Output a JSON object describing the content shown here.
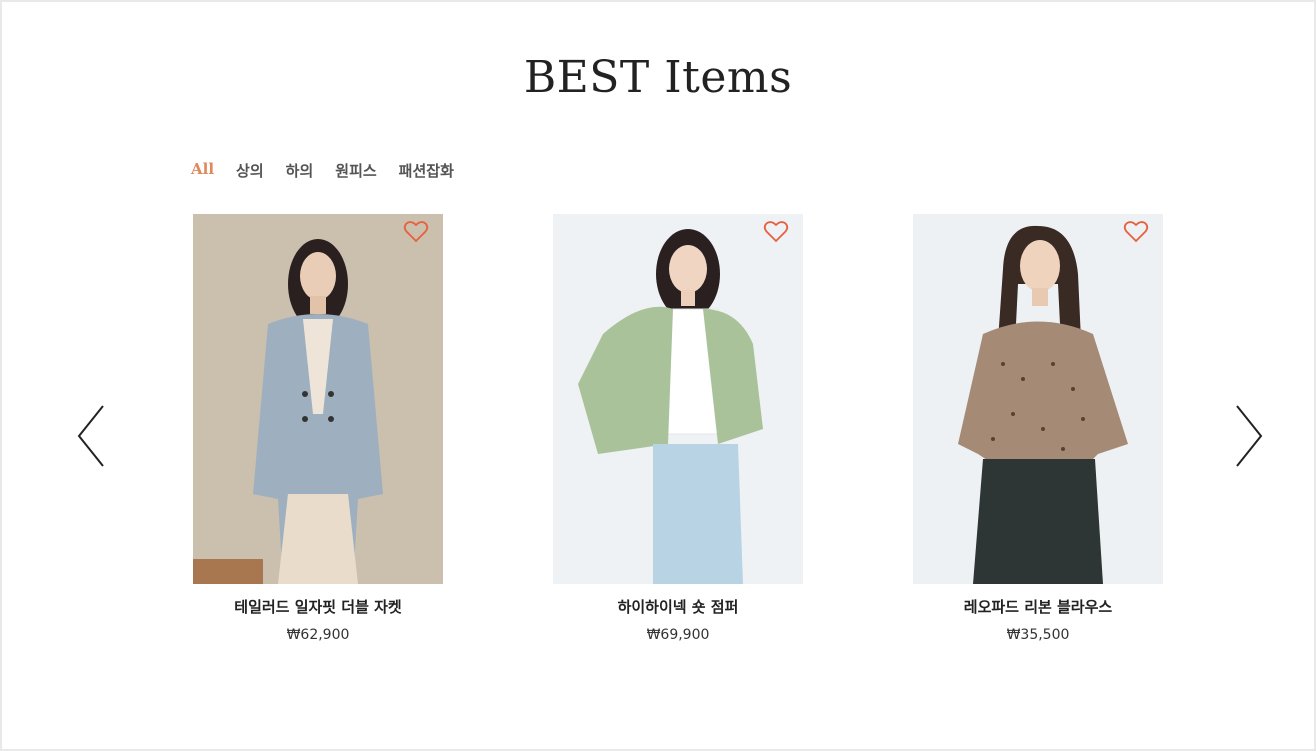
{
  "section": {
    "title": "BEST Items"
  },
  "tabs": [
    {
      "label": "All",
      "active": true
    },
    {
      "label": "상의",
      "active": false
    },
    {
      "label": "하의",
      "active": false
    },
    {
      "label": "원피스",
      "active": false
    },
    {
      "label": "패션잡화",
      "active": false
    }
  ],
  "colors": {
    "accent": "#e0885a",
    "heart": "#e7603f"
  },
  "products": [
    {
      "name": "테일러드 일자핏 더블 자켓",
      "price": "₩62,900",
      "icon": "heart-outline-icon"
    },
    {
      "name": "하이하이넥 숏 점퍼",
      "price": "₩69,900",
      "icon": "heart-outline-icon"
    },
    {
      "name": "레오파드 리본 블라우스",
      "price": "₩35,500",
      "icon": "heart-outline-icon"
    }
  ],
  "navigation": {
    "prev_icon": "chevron-left-icon",
    "next_icon": "chevron-right-icon"
  }
}
